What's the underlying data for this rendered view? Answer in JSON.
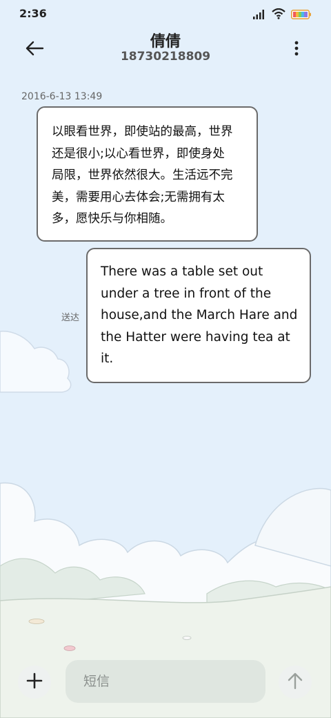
{
  "status_bar": {
    "time": "2:36",
    "icons": [
      "signal-icon",
      "wifi-icon",
      "battery-icon"
    ]
  },
  "header": {
    "back_icon": "arrow-left-icon",
    "contact_name": "倩倩",
    "contact_number": "18730218809",
    "more_icon": "more-vertical-icon"
  },
  "conversation": {
    "timestamp": "2016-6-13 13:49",
    "messages": [
      {
        "direction": "incoming",
        "lines": [
          "以眼看世界，即使站的最高，世界",
          "还是很小;以心看世界，即使身处",
          "局限，世界依然很大。生活远不完",
          "美，需要用心去体会;无需拥有太",
          "多，愿快乐与你相随。"
        ]
      },
      {
        "direction": "outgoing",
        "lines": [
          "There was a table set out",
          "under a tree in front of the",
          "house,and the March Hare and",
          "the Hatter were having tea at",
          "it."
        ],
        "status": "送达"
      }
    ]
  },
  "composer": {
    "add_icon": "plus-icon",
    "placeholder": "短信",
    "value": "",
    "send_icon": "arrow-up-icon"
  },
  "colors": {
    "sky": "#e4f0fb",
    "bubble_border": "#6a6a6a",
    "grass": "#eef3ec"
  }
}
